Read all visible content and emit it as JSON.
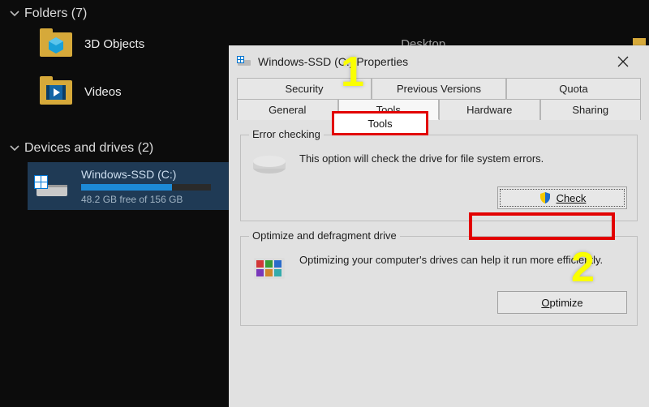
{
  "explorer": {
    "sections": {
      "folders": {
        "title": "Folders (7)"
      },
      "devices": {
        "title": "Devices and drives (2)"
      }
    },
    "folders": [
      {
        "label": "3D Objects"
      },
      {
        "label": "Desktop"
      },
      {
        "label": "Videos"
      }
    ],
    "drive": {
      "name": "Windows-SSD (C:)",
      "free_text": "48.2 GB free of 156 GB"
    }
  },
  "dialog": {
    "title": "Windows-SSD (C:) Properties",
    "tabs_row1": [
      "Security",
      "Previous Versions",
      "Quota"
    ],
    "tabs_row2": [
      "General",
      "Tools",
      "Hardware",
      "Sharing"
    ],
    "active_tab": "Tools",
    "group_error": {
      "legend": "Error checking",
      "text": "This option will check the drive for file system errors.",
      "button_label": "Check"
    },
    "group_optimize": {
      "legend": "Optimize and defragment drive",
      "text": "Optimizing your computer's drives can help it run more efficiently.",
      "button_label": "Optimize"
    }
  },
  "annotations": {
    "one": "1",
    "two": "2",
    "tools_tab_label": "Tools"
  }
}
